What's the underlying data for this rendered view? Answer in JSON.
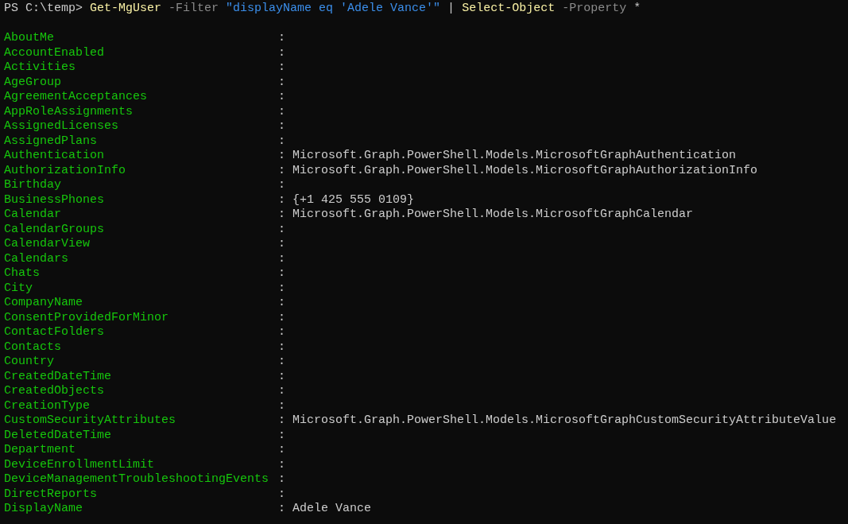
{
  "prompt": "PS C:\\temp>",
  "command": [
    {
      "kind": "command",
      "text": "Get-MgUser"
    },
    {
      "kind": "parameter",
      "text": "-Filter"
    },
    {
      "kind": "string",
      "text": "\"displayName eq 'Adele Vance'\""
    },
    {
      "kind": "operator",
      "text": "|"
    },
    {
      "kind": "command",
      "text": "Select-Object"
    },
    {
      "kind": "parameter",
      "text": "-Property"
    },
    {
      "kind": "operator",
      "text": "*"
    }
  ],
  "properties": [
    {
      "name": "AboutMe",
      "sep": ":"
    },
    {
      "name": "AccountEnabled",
      "sep": ":"
    },
    {
      "name": "Activities",
      "sep": ":"
    },
    {
      "name": "AgeGroup",
      "sep": ":"
    },
    {
      "name": "AgreementAcceptances",
      "sep": ":"
    },
    {
      "name": "AppRoleAssignments",
      "sep": ":"
    },
    {
      "name": "AssignedLicenses",
      "sep": ":"
    },
    {
      "name": "AssignedPlans",
      "sep": ":"
    },
    {
      "name": "Authentication",
      "sep": ":",
      "value": "Microsoft.Graph.PowerShell.Models.MicrosoftGraphAuthentication"
    },
    {
      "name": "AuthorizationInfo",
      "sep": ":",
      "value": "Microsoft.Graph.PowerShell.Models.MicrosoftGraphAuthorizationInfo"
    },
    {
      "name": "Birthday",
      "sep": ":"
    },
    {
      "name": "BusinessPhones",
      "sep": ":",
      "value": "{+1 425 555 0109}"
    },
    {
      "name": "Calendar",
      "sep": ":",
      "value": "Microsoft.Graph.PowerShell.Models.MicrosoftGraphCalendar"
    },
    {
      "name": "CalendarGroups",
      "sep": ":"
    },
    {
      "name": "CalendarView",
      "sep": ":"
    },
    {
      "name": "Calendars",
      "sep": ":"
    },
    {
      "name": "Chats",
      "sep": ":"
    },
    {
      "name": "City",
      "sep": ":"
    },
    {
      "name": "CompanyName",
      "sep": ":"
    },
    {
      "name": "ConsentProvidedForMinor",
      "sep": ":"
    },
    {
      "name": "ContactFolders",
      "sep": ":"
    },
    {
      "name": "Contacts",
      "sep": ":"
    },
    {
      "name": "Country",
      "sep": ":"
    },
    {
      "name": "CreatedDateTime",
      "sep": ":"
    },
    {
      "name": "CreatedObjects",
      "sep": ":"
    },
    {
      "name": "CreationType",
      "sep": ":"
    },
    {
      "name": "CustomSecurityAttributes",
      "sep": ":",
      "value": "Microsoft.Graph.PowerShell.Models.MicrosoftGraphCustomSecurityAttributeValue"
    },
    {
      "name": "DeletedDateTime",
      "sep": ":"
    },
    {
      "name": "Department",
      "sep": ":"
    },
    {
      "name": "DeviceEnrollmentLimit",
      "sep": ":"
    },
    {
      "name": "DeviceManagementTroubleshootingEvents",
      "sep": ":"
    },
    {
      "name": "DirectReports",
      "sep": ":"
    },
    {
      "name": "DisplayName",
      "sep": ":",
      "value": "Adele Vance"
    }
  ]
}
